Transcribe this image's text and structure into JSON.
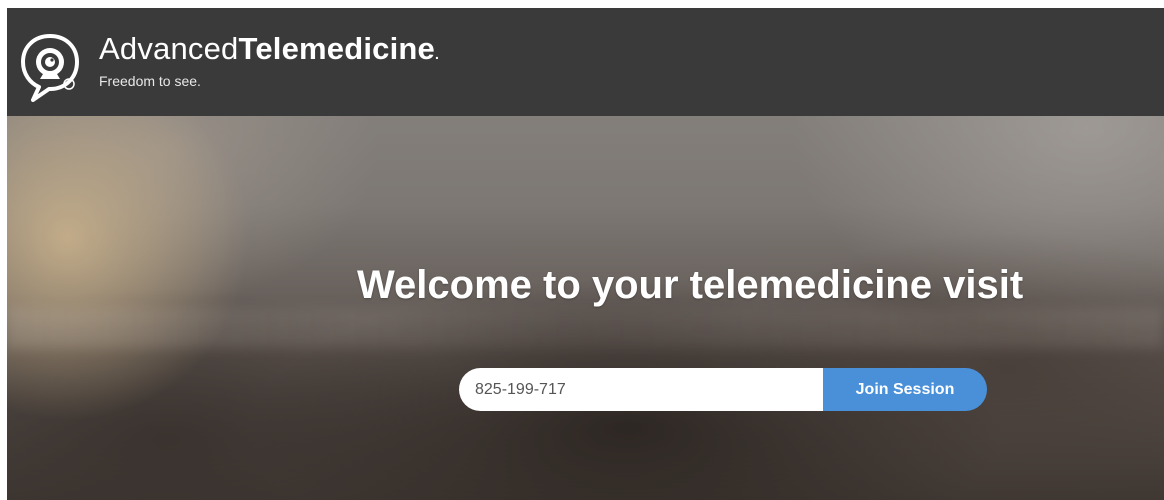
{
  "header": {
    "brand_light": "Advanced",
    "brand_bold": "Telemedicine",
    "brand_dot": ".",
    "tagline": "Freedom to see.",
    "logo_icon": "webcam-speech-bubble-icon"
  },
  "main": {
    "welcome_title": "Welcome to your telemedicine visit",
    "session_input_value": "825-199-717",
    "join_button_label": "Join Session"
  },
  "colors": {
    "header_bg": "#3a3a3a",
    "button_bg": "#4a90d9",
    "text": "#ffffff"
  }
}
